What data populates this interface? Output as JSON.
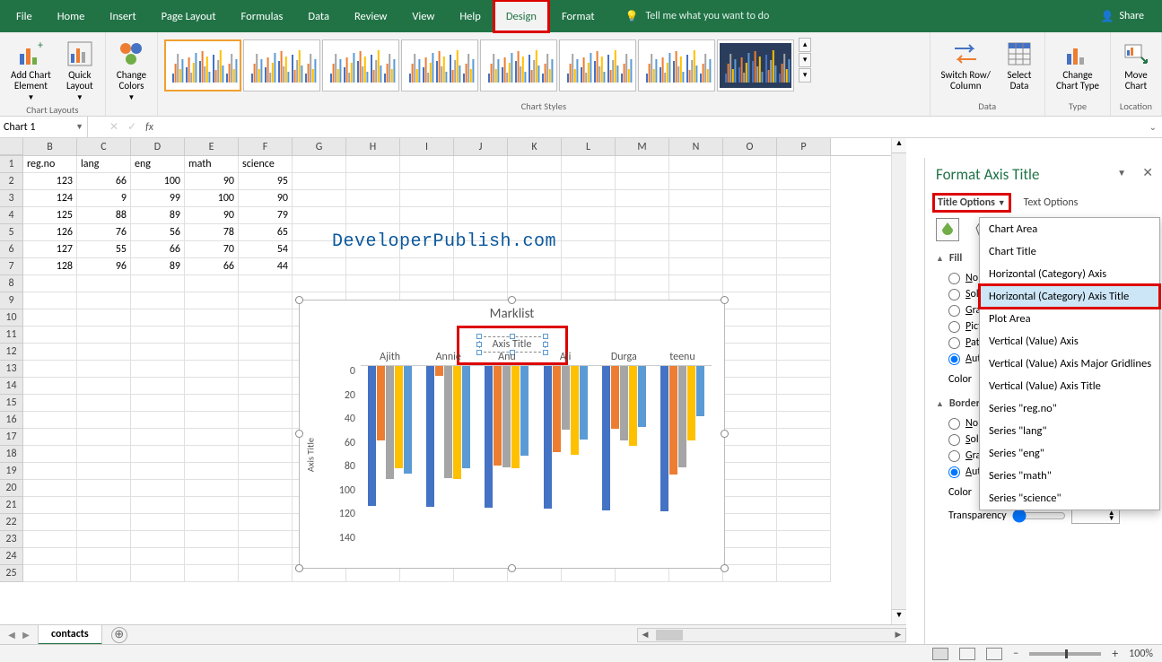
{
  "ribbon": {
    "tabs": [
      "File",
      "Home",
      "Insert",
      "Page Layout",
      "Formulas",
      "Data",
      "Review",
      "View",
      "Help",
      "Design",
      "Format"
    ],
    "active_tab": "Design",
    "highlighted_tab": "Design",
    "tell_me": "Tell me what you want to do",
    "share": "Share",
    "groups": {
      "chart_layouts": {
        "label": "Chart Layouts",
        "add_chart_element": "Add Chart\nElement",
        "quick_layout": "Quick\nLayout"
      },
      "change_colors": {
        "label": "Change\nColors"
      },
      "chart_styles": {
        "label": "Chart Styles"
      },
      "data": {
        "label": "Data",
        "switch": "Switch Row/\nColumn",
        "select": "Select\nData"
      },
      "type": {
        "label": "Type",
        "change_type": "Change\nChart Type"
      },
      "location": {
        "label": "Location",
        "move_chart": "Move\nChart"
      }
    }
  },
  "name_box": "Chart 1",
  "fx": "fx",
  "columns": [
    "B",
    "C",
    "D",
    "E",
    "F",
    "G",
    "H",
    "I",
    "J",
    "K",
    "L",
    "M",
    "N",
    "O",
    "P"
  ],
  "headers": [
    "reg.no",
    "lang",
    "eng",
    "math",
    "science"
  ],
  "rows": [
    [
      123,
      66,
      100,
      90,
      95
    ],
    [
      124,
      9,
      99,
      100,
      90
    ],
    [
      125,
      88,
      89,
      90,
      79
    ],
    [
      126,
      76,
      56,
      78,
      65
    ],
    [
      127,
      55,
      66,
      70,
      54
    ],
    [
      128,
      96,
      89,
      66,
      44
    ]
  ],
  "extra_row_count": 18,
  "watermark": "DeveloperPublish.com",
  "chart": {
    "title": "Marklist",
    "axis_title": "Axis Title",
    "y_axis_title": "Axis Title",
    "categories": [
      "Ajith",
      "Annie",
      "Anu",
      "Aji",
      "Durga",
      "teenu"
    ]
  },
  "chart_data": {
    "type": "bar",
    "title": "Marklist",
    "subtitle": "Axis Title",
    "xlabel": "",
    "ylabel": "Axis Title",
    "ylim": [
      0,
      140
    ],
    "y_reversed": true,
    "y_ticks": [
      0,
      20,
      40,
      60,
      80,
      100,
      120,
      140
    ],
    "categories": [
      "Ajith",
      "Annie",
      "Anu",
      "Aji",
      "Durga",
      "teenu"
    ],
    "series": [
      {
        "name": "reg.no",
        "color": "#4472C4",
        "values": [
          123,
          124,
          125,
          126,
          127,
          128
        ]
      },
      {
        "name": "lang",
        "color": "#ED7D31",
        "values": [
          66,
          9,
          88,
          76,
          55,
          96
        ]
      },
      {
        "name": "eng",
        "color": "#A5A5A5",
        "values": [
          100,
          99,
          89,
          56,
          66,
          89
        ]
      },
      {
        "name": "math",
        "color": "#FFC000",
        "values": [
          90,
          100,
          90,
          78,
          70,
          66
        ]
      },
      {
        "name": "science",
        "color": "#5B9BD5",
        "values": [
          95,
          90,
          79,
          65,
          54,
          44
        ]
      }
    ]
  },
  "format_pane": {
    "title": "Format Axis Title",
    "tab_title_options": "Title Options",
    "tab_text_options": "Text Options",
    "fill": {
      "label": "Fill",
      "options": [
        "No fill",
        "Solid fill",
        "Gradient fill",
        "Picture or texture fill",
        "Pattern fill",
        "Automatic"
      ],
      "selected": "Automatic",
      "color_label": "Color"
    },
    "border": {
      "label": "Border",
      "options": [
        "No line",
        "Solid line",
        "Gradient line",
        "Automatic"
      ],
      "selected": "Automatic",
      "color_label": "Color",
      "transparency_label": "Transparency"
    },
    "dropdown_items": [
      "Chart Area",
      "Chart Title",
      "Horizontal (Category) Axis",
      "Horizontal (Category) Axis Title",
      "Plot Area",
      "Vertical (Value) Axis",
      "Vertical (Value) Axis Major Gridlines",
      "Vertical (Value) Axis Title",
      "Series \"reg.no\"",
      "Series \"lang\"",
      "Series \"eng\"",
      "Series \"math\"",
      "Series \"science\""
    ],
    "dropdown_selected": "Horizontal (Category) Axis Title"
  },
  "sheet_tab": "contacts",
  "zoom": "100%"
}
